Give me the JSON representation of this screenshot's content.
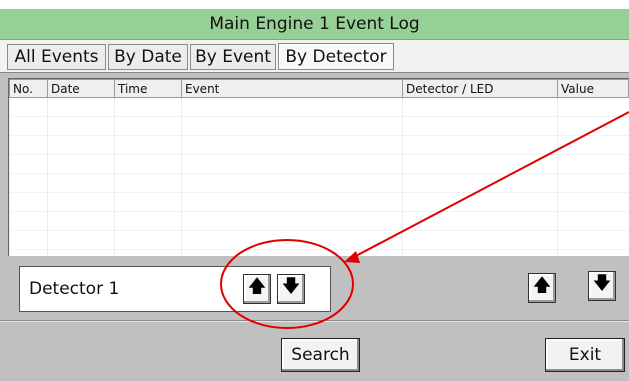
{
  "window": {
    "title": "Main Engine 1 Event Log"
  },
  "tabs": [
    {
      "label": "All Events"
    },
    {
      "label": "By Date"
    },
    {
      "label": "By Event"
    },
    {
      "label": "By Detector",
      "active": true
    }
  ],
  "table": {
    "columns": [
      "No.",
      "Date",
      "Time",
      "Event",
      "Detector / LED",
      "Value"
    ],
    "rows": []
  },
  "detector_selector": {
    "value": "Detector 1",
    "up_icon": "arrow-up-icon",
    "down_icon": "arrow-down-icon"
  },
  "scroll": {
    "up_icon": "arrow-up-icon",
    "down_icon": "arrow-down-icon"
  },
  "buttons": {
    "search": "Search",
    "exit": "Exit"
  },
  "annotation": {
    "color": "#e00000"
  }
}
